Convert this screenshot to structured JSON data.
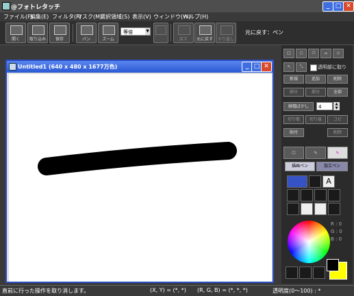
{
  "app": {
    "title": "@フォトレタッチ"
  },
  "menu": [
    "ファイル(F)",
    "編集(E)",
    "フィルタ(P)",
    "マスク(M)",
    "選択領域(S)",
    "表示(V)",
    "ウィンドウ(W)",
    "ヘルプ(H)"
  ],
  "toolbar": {
    "buttons": [
      {
        "label": "開く"
      },
      {
        "label": "取り込み"
      },
      {
        "label": "保存"
      },
      {
        "label": "パン"
      },
      {
        "label": "ズーム"
      },
      {
        "label": "戻す"
      },
      {
        "label": "元に戻す"
      },
      {
        "label": "やり直し"
      }
    ],
    "zoom_value": "等倍",
    "status": "元に戻す：ペン"
  },
  "document": {
    "title": "Untitled1 (640 x 480 x 1677万色)"
  },
  "panel": {
    "transparent_label": "透明部に取り",
    "buttons": [
      "新規",
      "追加",
      "削除",
      "部分",
      "部分",
      "全部"
    ],
    "brush_label": "線幅ばかし",
    "brush_value": "4",
    "buttons2": [
      "切り取",
      "切り抜",
      "コピ",
      "貼付",
      "削除"
    ],
    "tabs": [
      "描画ペン",
      "加工ペン"
    ],
    "rgb": {
      "r": "R : 0",
      "g": "G : 0",
      "b": "B : 0"
    }
  },
  "status": {
    "message": "直前に行った操作を取り消します。",
    "coords": "(X, Y) = (*, *)",
    "rgb": "(R, G, B) = (*, *, *)",
    "transparency": "透明度(0〜100) : *"
  },
  "colors": {
    "foreground": "#000000",
    "background": "#ffff00",
    "accent": "#2a58d4"
  }
}
